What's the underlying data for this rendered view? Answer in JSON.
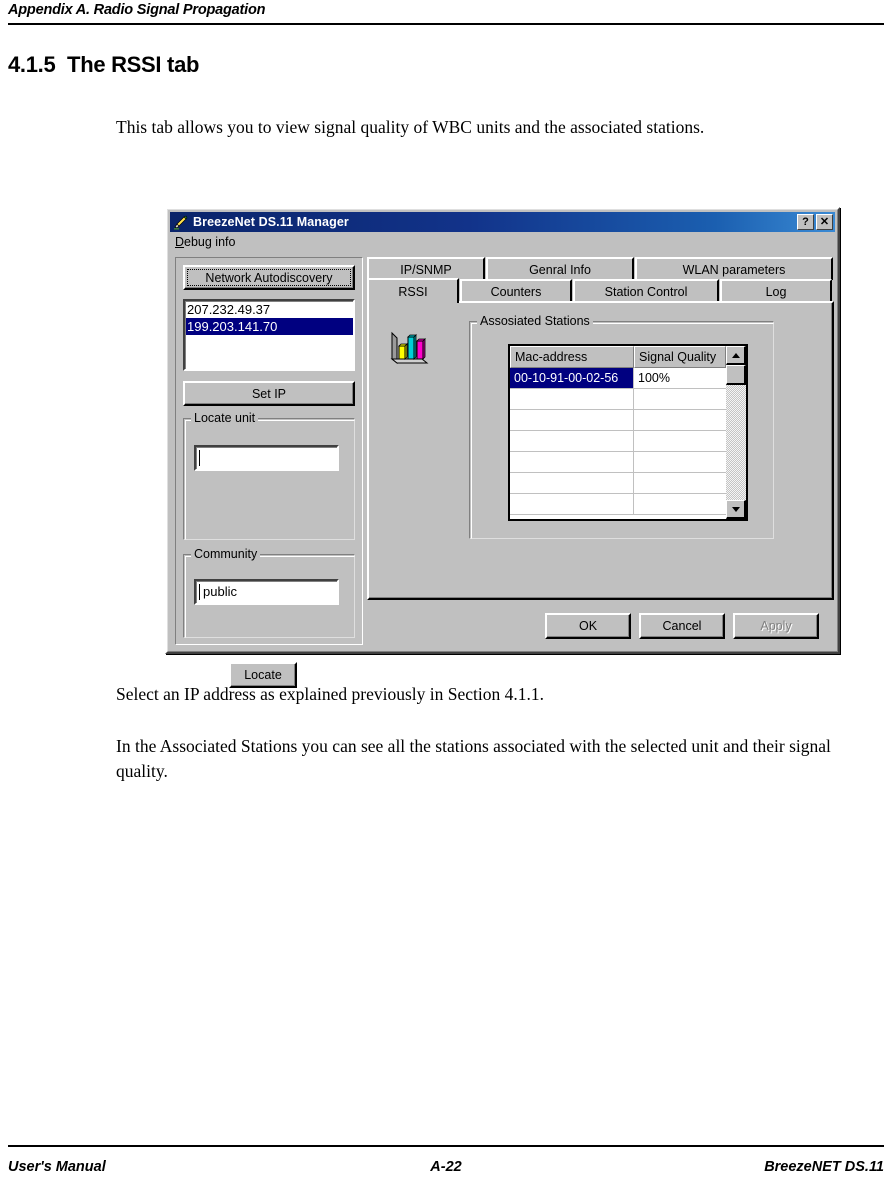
{
  "page": {
    "running_header": "Appendix A. Radio Signal Propagation",
    "section_number_title": "4.1.5  The RSSI tab",
    "paragraph_intro": "This tab allows you to view signal quality of WBC units and the associated stations.",
    "paragraph_select": "Select an IP address as explained previously in Section 4.1.1.",
    "paragraph_assoc": "In the Associated Stations you can see all the stations associated with the selected unit and their signal quality.",
    "footer_left": "User's Manual",
    "footer_center": "A-22",
    "footer_right": "BreezeNET DS.11"
  },
  "dialog": {
    "title": "BreezeNet DS.11 Manager",
    "title_icon": "pencil-icon",
    "titlebar_buttons": [
      {
        "name": "help-button",
        "glyph": "?"
      },
      {
        "name": "close-button",
        "glyph": "✕"
      }
    ],
    "menu": [
      {
        "label_prefix": "D",
        "label_rest": "ebug info",
        "full": "Debug info"
      }
    ],
    "left_panel": {
      "autodiscovery_button": "Network Autodiscovery",
      "ip_list": [
        {
          "address": "207.232.49.37",
          "selected": false
        },
        {
          "address": "199.203.141.70",
          "selected": true
        }
      ],
      "set_ip_button": "Set IP",
      "locate_group": {
        "title": "Locate unit",
        "input_value": "",
        "locate_button": "Locate"
      },
      "community_group": {
        "title": "Community",
        "input_value": "public"
      }
    },
    "tabs_row1": [
      {
        "label": "IP/SNMP",
        "active": false
      },
      {
        "label": "Genral Info",
        "active": false
      },
      {
        "label": "WLAN parameters",
        "active": false
      }
    ],
    "tabs_row2": [
      {
        "label": "RSSI",
        "active": true
      },
      {
        "label": "Counters",
        "active": false
      },
      {
        "label": "Station Control",
        "active": false
      },
      {
        "label": "Log",
        "active": false
      }
    ],
    "rssi_panel": {
      "chart_icon": "bar-chart-icon",
      "group_title": "Assosiated Stations",
      "columns": [
        "Mac-address",
        "Signal Quality"
      ],
      "rows": [
        {
          "mac": "00-10-91-00-02-56",
          "quality": "100%",
          "selected": true
        },
        {
          "mac": "",
          "quality": "",
          "selected": false
        },
        {
          "mac": "",
          "quality": "",
          "selected": false
        },
        {
          "mac": "",
          "quality": "",
          "selected": false
        },
        {
          "mac": "",
          "quality": "",
          "selected": false
        },
        {
          "mac": "",
          "quality": "",
          "selected": false
        },
        {
          "mac": "",
          "quality": "",
          "selected": false
        }
      ],
      "scrollbar": {
        "up_arrow": "scroll-up-icon",
        "down_arrow": "scroll-down-icon"
      }
    },
    "footer_buttons": [
      {
        "label": "OK",
        "disabled": false
      },
      {
        "label": "Cancel",
        "disabled": false
      },
      {
        "label": "Apply",
        "disabled": true
      }
    ],
    "colors": {
      "face": "#c0c0c0",
      "title_left": "#0a246a",
      "title_right": "#3a8ad4",
      "selection": "#000080",
      "chart_bar_1": "#ffff00",
      "chart_bar_2": "#00cfd6",
      "chart_bar_3": "#ff00cc"
    }
  }
}
